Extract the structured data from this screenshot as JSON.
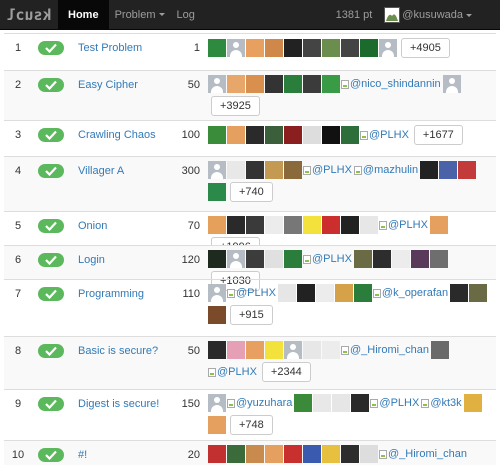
{
  "nav": {
    "brand": "ksuɔl",
    "home": "Home",
    "problem": "Problem",
    "log": "Log",
    "points": "1381 pt",
    "user": "@kusuwada"
  },
  "colors": {
    "navbar": "#222222",
    "link": "#337ab7",
    "success": "#5cb85c"
  },
  "rows": [
    {
      "rank": "1",
      "name": "Test Problem",
      "score": "1",
      "more": "+4905",
      "solvers": [
        "#2d8a3e",
        "person",
        "#e8a060",
        "#d0884a",
        "#222",
        "#444",
        "#6b8e4e",
        "#444",
        "#1d6b2c",
        "person"
      ]
    },
    {
      "rank": "2",
      "name": "Easy Cipher",
      "score": "50",
      "more": "+3925",
      "solvers": [
        "person",
        "#e7a76b",
        "#d9904e",
        "#333",
        "#2a7d3a",
        "#3b3b3b",
        "#3a9b46",
        "@nico_shindannin",
        "person"
      ]
    },
    {
      "rank": "3",
      "name": "Crawling Chaos",
      "score": "100",
      "more": "+1677",
      "solvers": [
        "#3a8c3a",
        "#e5a060",
        "#2a2a2a",
        "#3b5f3b",
        "#8b1e1e",
        "#dddddd",
        "#111",
        "#2d6e3a",
        "@PLHX"
      ]
    },
    {
      "rank": "4",
      "name": "Villager A",
      "score": "300",
      "more": "+740",
      "solvers": [
        "person",
        "#e8e8e8",
        "#333",
        "#c49a52",
        "#8a6a3a",
        "@PLHX",
        "@mazhulin",
        "#222",
        "#4a63a8",
        "#c23a3a",
        "#2b8a4a"
      ]
    },
    {
      "rank": "5",
      "name": "Onion",
      "score": "70",
      "more": "+1996",
      "solvers": [
        "#e5a15c",
        "#2a2a2a",
        "#3a3a3a",
        "#ececec",
        "#777",
        "#f3e23b",
        "#cc2e2e",
        "#222",
        "#e7e7e7",
        "@PLHX",
        "#e59f5e"
      ]
    },
    {
      "rank": "6",
      "name": "Login",
      "score": "120",
      "more": "+1030",
      "solvers": [
        "#1f2a1f",
        "person",
        "#3c3c3c",
        "#e0e0e0",
        "#2a7d3a",
        "@PLHX",
        "#6a6a44",
        "#2d2d2d",
        "#ececec",
        "#5a3a5a",
        "#6e6e6e"
      ]
    },
    {
      "rank": "7",
      "name": "Programming",
      "score": "110",
      "more": "+915",
      "solvers": [
        "person",
        "@PLHX",
        "#e6e6e6",
        "#222",
        "#ececec",
        "#d5a24a",
        "#2a7d3a",
        "@k_operafan",
        "#2a2a2a",
        "#6a6a44",
        "#7a4a2a"
      ]
    },
    {
      "rank": "8",
      "name": "Basic is secure?",
      "score": "50",
      "more": "+2344",
      "solvers": [
        "#2a2a2a",
        "#e5a0b5",
        "#e8a060",
        "#f3e23b",
        "person",
        "#e7e7e7",
        "#ececec",
        "@_Hiromi_chan",
        "#6a6a6a",
        "@PLHX"
      ]
    },
    {
      "rank": "9",
      "name": "Digest is secure!",
      "score": "150",
      "more": "+748",
      "solvers": [
        "person",
        "@yuzuhara",
        "#3a8a3a",
        "#e8e8e8",
        "#e6e6e6",
        "#2a2a2a",
        "@PLHX",
        "@kt3k",
        "#e0b040",
        "#e59f5e"
      ]
    },
    {
      "rank": "10",
      "name": "#!",
      "score": "20",
      "more": "",
      "solvers": [
        "#c23030",
        "#3b6b3b",
        "#c98a4e",
        "#e5a060",
        "#c83030",
        "#3a5ab0",
        "#e8c040",
        "#2d2d2d",
        "#dddddd",
        "@_Hiromi_chan"
      ]
    }
  ]
}
